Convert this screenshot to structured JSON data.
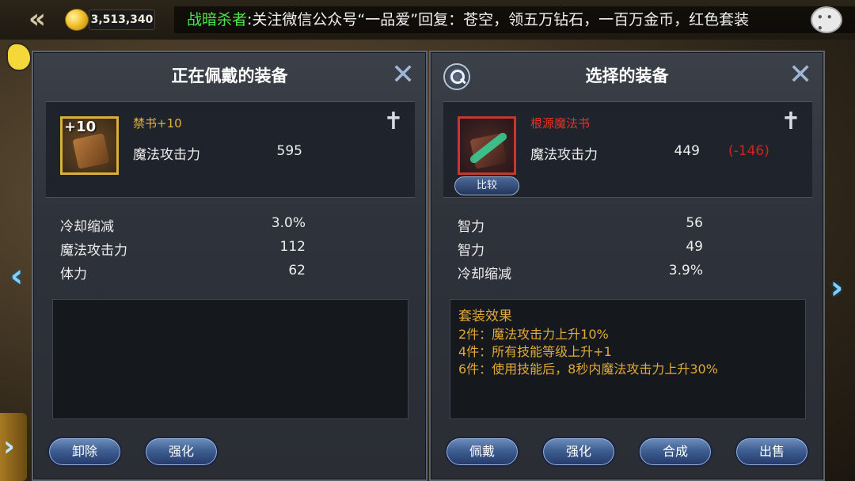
{
  "topbar": {
    "coins": "3,513,340",
    "marquee_speaker": "战暗杀者",
    "marquee_separator": ":",
    "marquee_message": "关注微信公众号“一品爱”回复：苍空，领五万钻石，一百万金币，红色套装"
  },
  "equipped": {
    "title": "正在佩戴的装备",
    "item": {
      "level_badge": "+10",
      "name": "禁书+10",
      "main_stat_label": "魔法攻击力",
      "main_stat_value": "595"
    },
    "stats": [
      {
        "label": "冷却缩减",
        "value": "3.0%"
      },
      {
        "label": "魔法攻击力",
        "value": "112"
      },
      {
        "label": "体力",
        "value": "62"
      }
    ],
    "buttons": {
      "unequip": "卸除",
      "enhance": "强化"
    }
  },
  "selected": {
    "title": "选择的装备",
    "item": {
      "name": "根源魔法书",
      "main_stat_label": "魔法攻击力",
      "main_stat_value": "449",
      "main_stat_diff": "(-146)",
      "compare_label": "比较"
    },
    "stats": [
      {
        "label": "智力",
        "value": "56"
      },
      {
        "label": "智力",
        "value": "49"
      },
      {
        "label": "冷却缩减",
        "value": "3.9%"
      }
    ],
    "set_effect": {
      "title": "套装效果",
      "lines": [
        "2件：魔法攻击力上升10%",
        "4件：所有技能等级上升+1",
        "6件：使用技能后，8秒内魔法攻击力上升30%"
      ]
    },
    "buttons": {
      "equip": "佩戴",
      "enhance": "强化",
      "combine": "合成",
      "sell": "出售"
    }
  },
  "colors": {
    "item_name_gold": "#e3b23c",
    "item_name_red": "#e2322a",
    "stat_diff_negative": "#c8281f",
    "speaker_green": "#4fe34f"
  }
}
